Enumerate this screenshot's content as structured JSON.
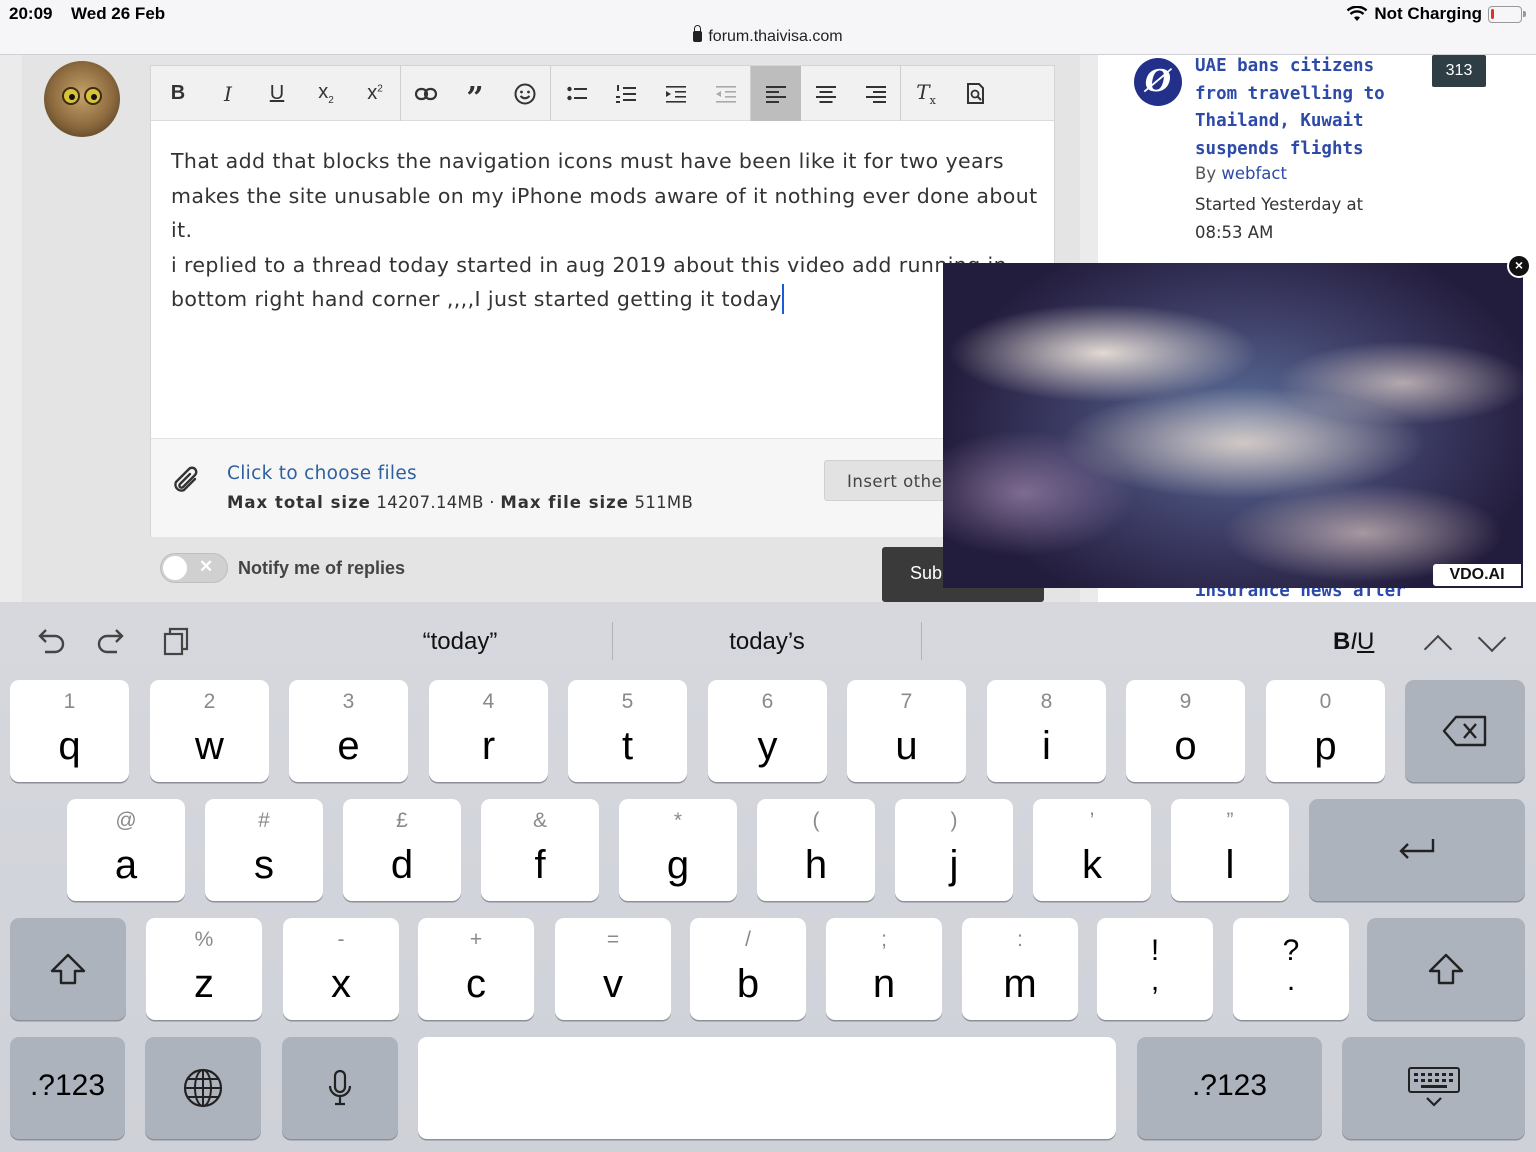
{
  "status": {
    "time": "20:09",
    "date": "Wed 26 Feb",
    "charging": "Not Charging",
    "battery_level": 0.1
  },
  "browser": {
    "url": "forum.thaivisa.com"
  },
  "editor": {
    "toolbar": [
      "bold",
      "italic",
      "underline",
      "subscript",
      "superscript",
      "link",
      "quote",
      "emoji",
      "bullet-list",
      "numbered-list",
      "indent",
      "outdent",
      "align-left",
      "align-center",
      "align-right",
      "clear-format",
      "preview"
    ],
    "paragraph1": "That add that blocks the navigation icons must have been like it for two years makes the site unusable on my iPhone mods aware of it nothing ever done about it.",
    "paragraph2": "i replied to a thread today started in aug 2019 about this video add running in bottom right hand corner ,,,,I just started getting it today"
  },
  "attach": {
    "link": "Click to choose files",
    "max_total_label": "Max total size",
    "max_total_value": "14207.14MB",
    "sep": "·",
    "max_file_label": "Max file size",
    "max_file_value": "511MB",
    "insert_button": "Insert other"
  },
  "notify": {
    "label": "Notify me of replies",
    "toggle_x": "✕"
  },
  "submit": {
    "label": "Submit"
  },
  "sidebar": {
    "icon_glyph": "Ø",
    "title": "UAE bans citizens from travelling to Thailand, Kuwait suspends flights",
    "by_prefix": "By",
    "author": "webfact",
    "started": "Started Yesterday at 08:53 AM",
    "count": "313",
    "peek": "insurance news after"
  },
  "ad": {
    "close": "×",
    "brand": "VDO.AI"
  },
  "keyboard": {
    "suggestions": [
      "“today”",
      "today’s"
    ],
    "biu": {
      "b": "B",
      "i": "I",
      "u": "U"
    },
    "row1": [
      {
        "s": "1",
        "m": "q"
      },
      {
        "s": "2",
        "m": "w"
      },
      {
        "s": "3",
        "m": "e"
      },
      {
        "s": "4",
        "m": "r"
      },
      {
        "s": "5",
        "m": "t"
      },
      {
        "s": "6",
        "m": "y"
      },
      {
        "s": "7",
        "m": "u"
      },
      {
        "s": "8",
        "m": "i"
      },
      {
        "s": "9",
        "m": "o"
      },
      {
        "s": "0",
        "m": "p"
      }
    ],
    "row2": [
      {
        "s": "@",
        "m": "a"
      },
      {
        "s": "#",
        "m": "s"
      },
      {
        "s": "£",
        "m": "d"
      },
      {
        "s": "&",
        "m": "f"
      },
      {
        "s": "*",
        "m": "g"
      },
      {
        "s": "(",
        "m": "h"
      },
      {
        "s": ")",
        "m": "j"
      },
      {
        "s": "’",
        "m": "k"
      },
      {
        "s": "”",
        "m": "l"
      }
    ],
    "row3": [
      {
        "s": "%",
        "m": "z"
      },
      {
        "s": "-",
        "m": "x"
      },
      {
        "s": "+",
        "m": "c"
      },
      {
        "s": "=",
        "m": "v"
      },
      {
        "s": "/",
        "m": "b"
      },
      {
        "s": ";",
        "m": "n"
      },
      {
        "s": ":",
        "m": "m"
      }
    ],
    "punct1": {
      "top": "!",
      "bottom": ","
    },
    "punct2": {
      "top": "?",
      "bottom": "."
    },
    "numbers_key": ".?123"
  }
}
